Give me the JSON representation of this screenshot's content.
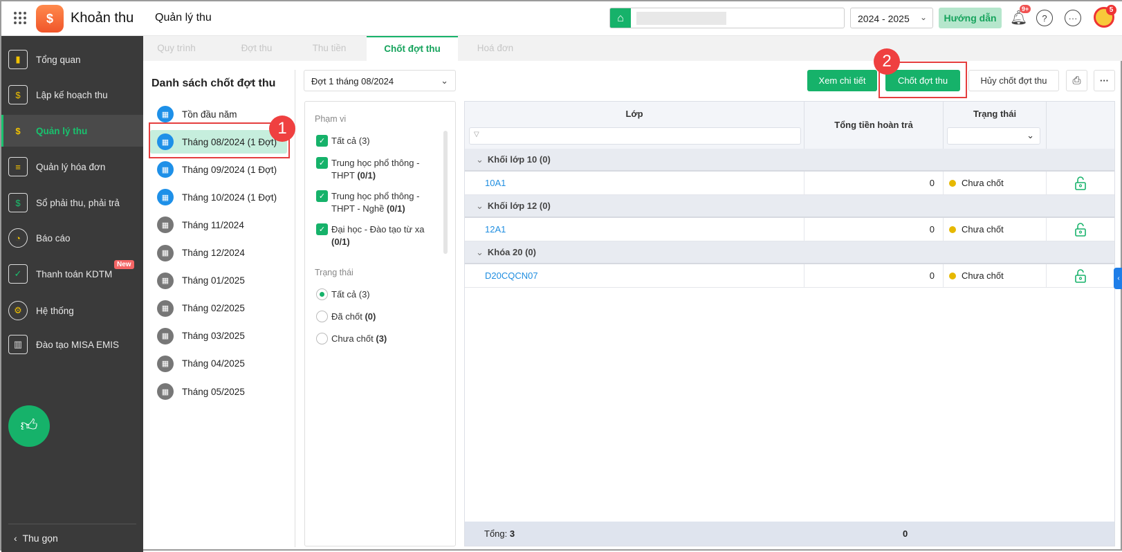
{
  "header": {
    "app_title": "Khoản thu",
    "page_title": "Quản lý thu",
    "year": "2024 - 2025",
    "guide_label": "Hướng dẫn",
    "notif_count": "9+",
    "avatar_count": "5"
  },
  "sidebar": {
    "items": [
      {
        "label": "Tổng quan",
        "icon": "chart-icon"
      },
      {
        "label": "Lập kế hoạch thu",
        "icon": "calendar-money-icon"
      },
      {
        "label": "Quản lý thu",
        "icon": "money-hand-icon"
      },
      {
        "label": "Quản lý hóa đơn",
        "icon": "invoice-icon"
      },
      {
        "label": "Sổ phải thu, phải trả",
        "icon": "ledger-icon"
      },
      {
        "label": "Báo cáo",
        "icon": "pie-chart-icon"
      },
      {
        "label": "Thanh toán KDTM",
        "icon": "card-icon",
        "badge": "New"
      },
      {
        "label": "Hệ thống",
        "icon": "gear-icon"
      },
      {
        "label": "Đào tạo MISA EMIS",
        "icon": "book-icon"
      }
    ],
    "collapse_label": "Thu gọn"
  },
  "tabs": [
    "Quy trình",
    "Đợt thu",
    "Thu tiền",
    "Chốt đợt thu",
    "Hoá đơn"
  ],
  "list": {
    "title": "Danh sách chốt đợt thu",
    "items": [
      "Tồn đầu năm",
      "Tháng 08/2024 (1 Đợt)",
      "Tháng 09/2024 (1 Đợt)",
      "Tháng 10/2024 (1 Đợt)",
      "Tháng 11/2024",
      "Tháng 12/2024",
      "Tháng 01/2025",
      "Tháng 02/2025",
      "Tháng 03/2025",
      "Tháng 04/2025",
      "Tháng 05/2025"
    ]
  },
  "annotations": {
    "step1": "1",
    "step2": "2"
  },
  "filter": {
    "period": "Đợt 1 tháng 08/2024",
    "scope_label": "Phạm vi",
    "scope": [
      {
        "text": "Tất cả (3)",
        "count": ""
      },
      {
        "text": "Trung học phổ thông - THPT",
        "count": "(0/1)"
      },
      {
        "text": "Trung học phổ thông - THPT - Nghề",
        "count": "(0/1)"
      },
      {
        "text": "Đại học - Đào tạo từ xa",
        "count": "(0/1)"
      }
    ],
    "status_label": "Trạng thái",
    "status": [
      {
        "text": "Tất cả (3)",
        "count": ""
      },
      {
        "text": "Đã chốt",
        "count": "(0)"
      },
      {
        "text": "Chưa chốt",
        "count": "(3)"
      }
    ]
  },
  "toolbar": {
    "view_detail": "Xem chi tiết",
    "close_period": "Chốt đợt thu",
    "cancel_close": "Hủy chốt đợt thu"
  },
  "table": {
    "columns": [
      "Lớp",
      "Tổng tiền hoàn trả",
      "Trạng thái"
    ],
    "groups": [
      {
        "name": "Khối lớp 10 (0)",
        "rows": [
          {
            "class": "10A1",
            "amount": "0",
            "status": "Chưa chốt"
          }
        ]
      },
      {
        "name": "Khối lớp 12 (0)",
        "rows": [
          {
            "class": "12A1",
            "amount": "0",
            "status": "Chưa chốt"
          }
        ]
      },
      {
        "name": "Khóa 20 (0)",
        "rows": [
          {
            "class": "D20CQCN07",
            "amount": "0",
            "status": "Chưa chốt"
          }
        ]
      }
    ],
    "footer": {
      "label": "Tổng:",
      "count": "3",
      "total": "0"
    }
  },
  "colors": {
    "brand": "#16b26a",
    "link": "#1e8de0",
    "pending": "#e6b800",
    "annotation": "#ef4040"
  }
}
